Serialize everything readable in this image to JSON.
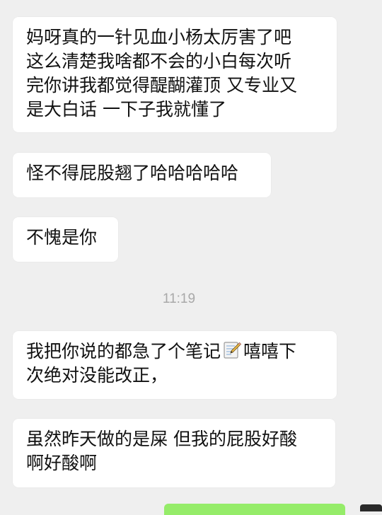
{
  "messages": [
    {
      "lines": [
        "妈呀真的一针见血小杨太厉害了吧",
        "这么清楚我啥都不会的小白每次听",
        "完你讲我都觉得醍醐灌顶 又专业又",
        "是大白话 一下子我就懂了"
      ]
    },
    {
      "lines": [
        "怪不得屁股翘了哈哈哈哈哈"
      ]
    },
    {
      "lines": [
        "不愧是你"
      ]
    },
    {
      "line1_before_icon": "我把你说的都急了个笔记",
      "line1_icon": "memo-icon",
      "line1_after_icon": "嘻嘻下",
      "line2": "次绝对没能改正，"
    },
    {
      "lines": [
        "虽然昨天做的是屎 但我的屁股好酸",
        "啊好酸啊"
      ]
    }
  ],
  "timestamp": "11:19",
  "colors": {
    "background": "#efefef",
    "bubble_incoming": "#ffffff",
    "bubble_outgoing": "#95ec69",
    "timestamp_text": "#a8a8a8"
  }
}
